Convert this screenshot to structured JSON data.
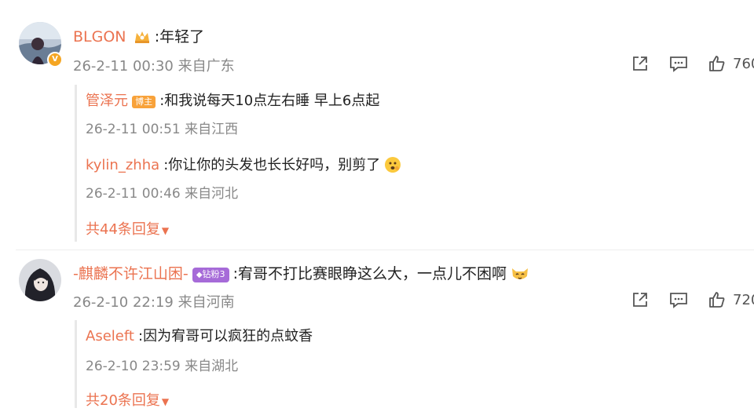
{
  "comments": [
    {
      "username": "BLGON",
      "text": ":年轻了",
      "meta": "26-2-11 00:30 来自广东",
      "likes": "760",
      "replies": [
        {
          "username": "管泽元",
          "tag": "博主",
          "text": ":和我说每天10点左右睡 早上6点起",
          "meta": "26-2-11 00:51 来自江西"
        },
        {
          "username": "kylin_zhha",
          "text": ":你让你的头发也长长好吗，别剪了",
          "meta": "26-2-11 00:46 来自河北"
        }
      ],
      "more_label": "共44条回复"
    },
    {
      "username": "-麒麟不许江山困-",
      "tag": "钻粉3",
      "text": ":宥哥不打比赛眼睁这么大，一点儿不困啊",
      "meta": "26-2-10 22:19 来自河南",
      "likes": "720",
      "replies": [
        {
          "username": "Aseleft",
          "text": ":因为宥哥可以疯狂的点蚊香",
          "meta": "26-2-10 23:59 来自湖北"
        }
      ],
      "more_label": "共20条回复"
    }
  ],
  "colors": {
    "accent": "#eb7350",
    "meta": "#888888",
    "text": "#222222"
  },
  "icons": [
    "share-icon",
    "comment-icon",
    "like-icon",
    "verified-icon",
    "crown-badge-icon",
    "diamond-icon",
    "emoji-icon"
  ]
}
